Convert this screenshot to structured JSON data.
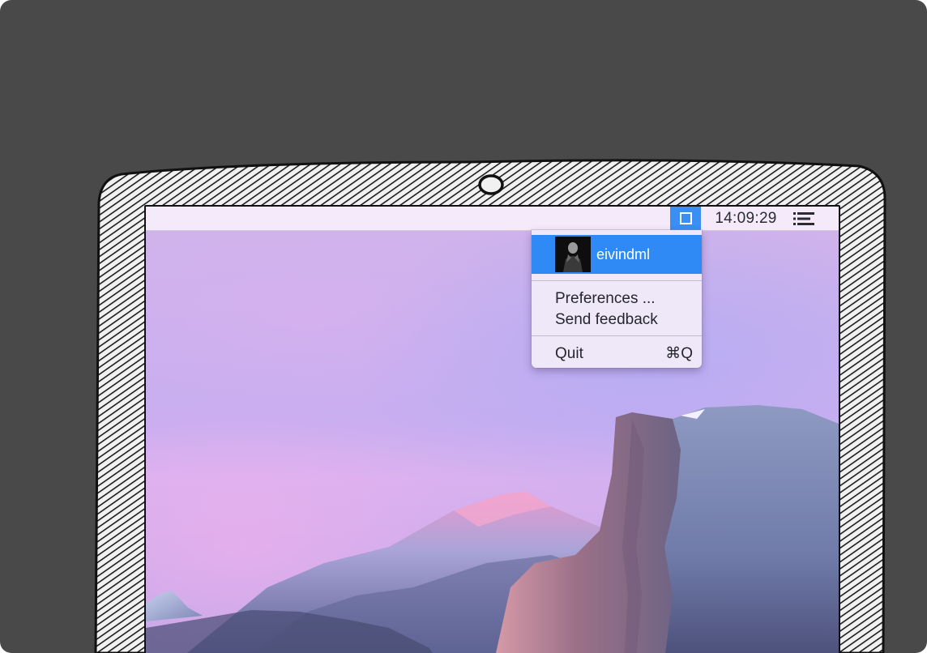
{
  "menubar": {
    "status_icon": "square-icon",
    "clock": "14:09:29",
    "list_icon": "list-icon"
  },
  "menu": {
    "user": {
      "name": "eivindml",
      "avatar_icon": "avatar-icon"
    },
    "items": [
      {
        "label": "Preferences ...",
        "shortcut": ""
      },
      {
        "label": "Send feedback",
        "shortcut": ""
      },
      {
        "label": "Quit",
        "shortcut": "⌘Q"
      }
    ]
  },
  "colors": {
    "accent": "#2f8af6",
    "background": "#494949",
    "menubar": "#f6ecfa"
  }
}
